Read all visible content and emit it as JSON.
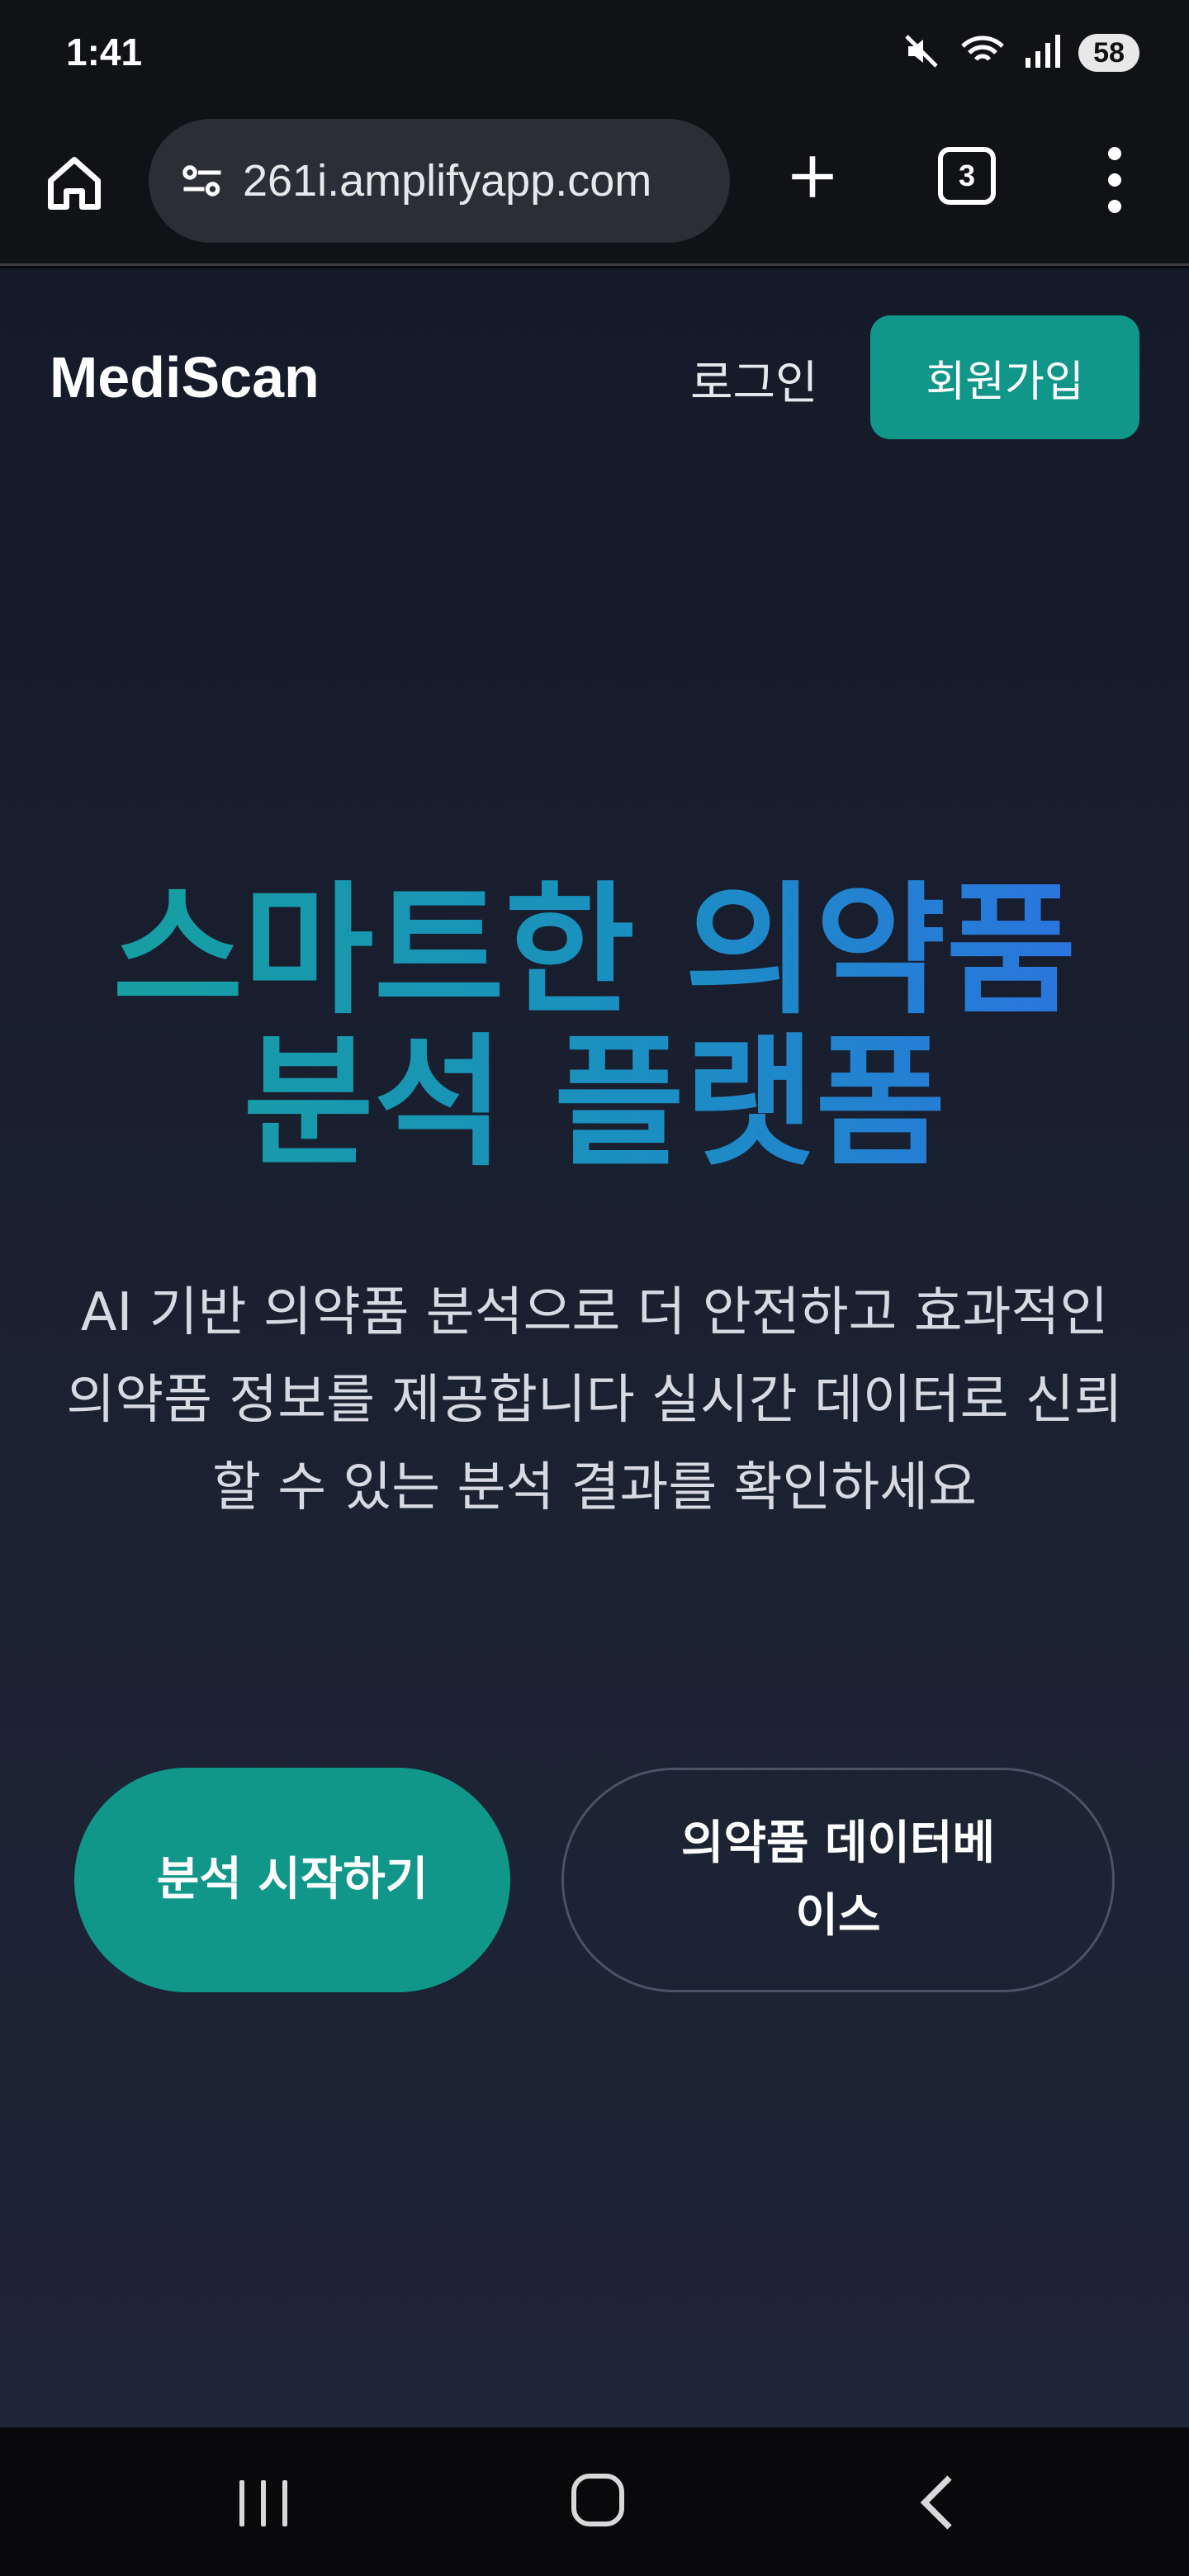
{
  "status_bar": {
    "time": "1:41",
    "icons": [
      "mute-icon",
      "wifi-icon",
      "signal-icon"
    ],
    "battery": "58"
  },
  "browser": {
    "url": "261i.amplifyapp.com",
    "tab_count": "3",
    "icons": [
      "home-icon",
      "tune-icon",
      "plus-icon",
      "more-vert-icon"
    ]
  },
  "nav": {
    "logo": "MediScan",
    "login": "로그인",
    "signup": "회원가입"
  },
  "hero": {
    "title_line1": "스마트한 의약품",
    "title_line2": "분석 플랫폼",
    "description": "AI 기반 의약품 분석으로 더 안전하고 효과적인 의약품 정보를 제공합니다 실시간 데이터로 신뢰할 수 있는 분석 결과를 확인하세요",
    "primary_button": "분석 시작하기",
    "secondary_button": "의약품 데이터베이스"
  },
  "colors": {
    "accent": "#11968a",
    "gradient_start": "#14a39a",
    "gradient_end": "#2f6ee6",
    "background": "#1b2232"
  }
}
